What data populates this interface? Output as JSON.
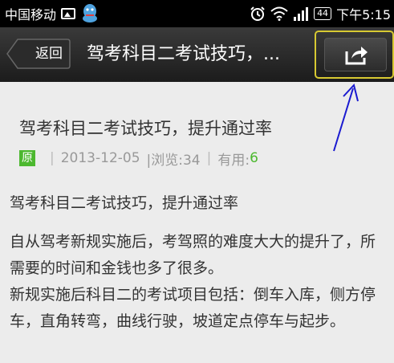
{
  "status_bar": {
    "carrier": "中国移动",
    "battery": "44",
    "time": "下午5:15",
    "icons": [
      "image-icon",
      "qq-icon",
      "alarm-icon",
      "wifi-icon",
      "signal-icon",
      "battery-icon"
    ]
  },
  "action_bar": {
    "back_label": "返回",
    "title": "驾考科目二考试技巧，...",
    "share_icon": "share-icon"
  },
  "article": {
    "title": "驾考科目二考试技巧，提升通过率",
    "badge": "原",
    "date": "2013-12-05",
    "views": "|浏览:34",
    "useful_label": "有用:",
    "useful_value": "6",
    "separator": "|",
    "sub_heading": "驾考科目二考试技巧，提升通过率",
    "paragraphs": [
      "自从驾考新规实施后，考驾照的难度大大的提升了，所需要的时间和金钱也多了很多。",
      "新规实施后科目二的考试项目包括：倒车入库，侧方停车，直角转弯，曲线行驶，坡道定点停车与起步。"
    ]
  },
  "colors": {
    "highlight_border": "#d7c932",
    "badge_green": "#4cb82f",
    "annotation_arrow": "#1a1ad0"
  }
}
